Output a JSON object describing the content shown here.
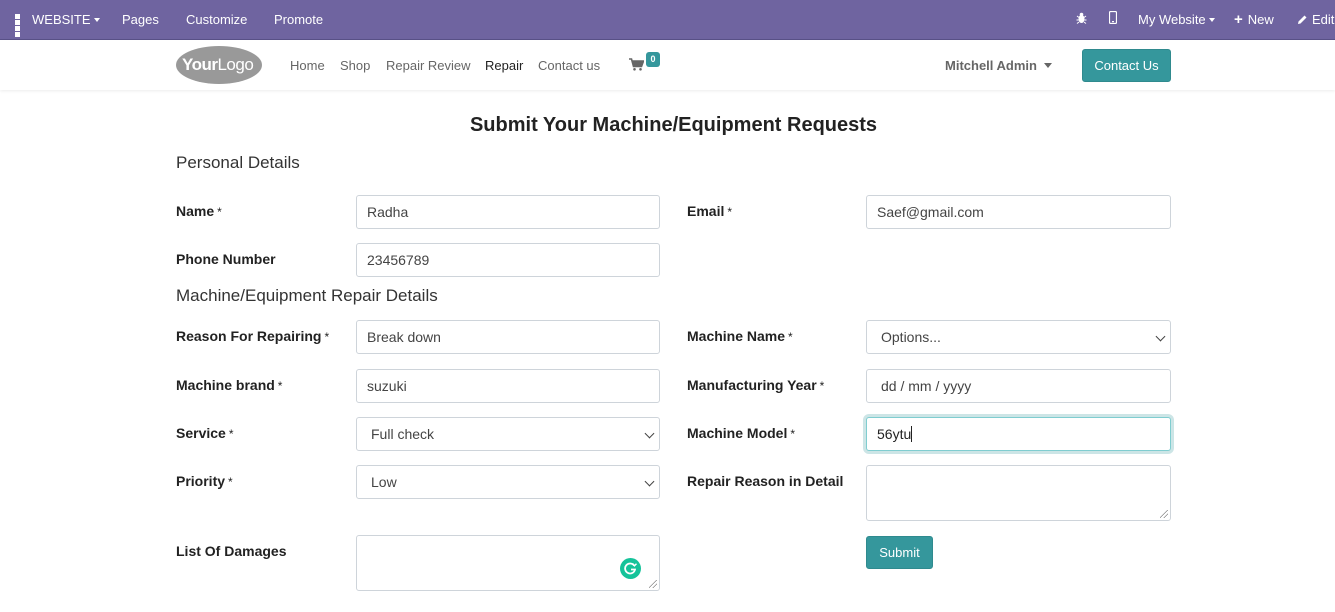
{
  "adminbar": {
    "website_label": "WEBSITE",
    "pages_label": "Pages",
    "customize_label": "Customize",
    "promote_label": "Promote",
    "my_website_label": "My Website",
    "new_label": "New",
    "edit_label": "Edit"
  },
  "navbar": {
    "logo_text_bold": "Your",
    "logo_text_light": "Logo",
    "links": [
      "Home",
      "Shop",
      "Repair Review",
      "Repair",
      "Contact us"
    ],
    "active_link": "Repair",
    "cart_count": "0",
    "user_name": "Mitchell Admin",
    "contact_button": "Contact Us"
  },
  "form": {
    "title": "Submit Your Machine/Equipment Requests",
    "personal_section": "Personal Details",
    "repair_section": "Machine/Equipment Repair Details",
    "required_marker": "*",
    "name_label": "Name",
    "name_value": "Radha",
    "email_label": "Email",
    "email_value": "Saef@gmail.com",
    "phone_label": "Phone Number",
    "phone_value": "23456789",
    "reason_label": "Reason For Repairing",
    "reason_value": "Break down",
    "machine_name_label": "Machine Name",
    "machine_name_value": "Options...",
    "brand_label": "Machine brand",
    "brand_value": "suzuki",
    "year_label": "Manufacturing Year",
    "year_placeholder": "dd / mm / yyyy",
    "service_label": "Service",
    "service_value": "Full check",
    "model_label": "Machine Model",
    "model_value": "56ytu",
    "priority_label": "Priority",
    "priority_value": "Low",
    "detail_label": "Repair Reason in Detail",
    "damages_label": "List Of Damages",
    "submit_label": "Submit"
  },
  "colors": {
    "admin_bar": "#6f64a0",
    "accent": "#35979c",
    "grammarly": "#15c39a"
  }
}
